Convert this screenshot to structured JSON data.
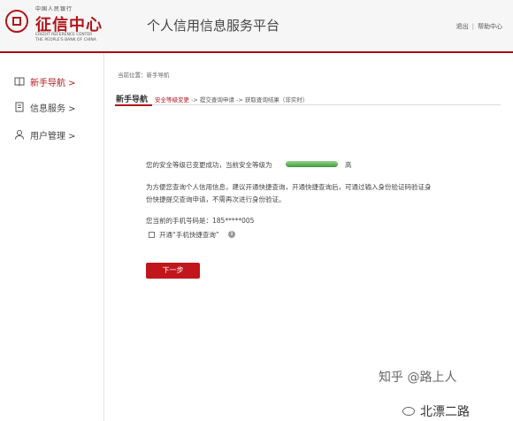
{
  "logo": {
    "top_text": "中国人民银行",
    "name": "征信中心",
    "en_line1": "CREDIT REFERENCE CENTER",
    "en_line2": "THE PEOPLE'S BANK OF CHINA"
  },
  "header": {
    "title": "个人信用信息服务平台",
    "logout": "退出",
    "separator": "|",
    "help": "帮助中心"
  },
  "sidebar": {
    "items": [
      {
        "label": "新手导航 >",
        "icon": "book-icon",
        "active": true
      },
      {
        "label": "信息服务 >",
        "icon": "document-icon",
        "active": false
      },
      {
        "label": "用户管理 >",
        "icon": "user-icon",
        "active": false
      }
    ]
  },
  "breadcrumb": "当前位置：新手导航",
  "section": {
    "title": "新手导航",
    "step_current": "安全等级变更",
    "step_rest": " -> 提交查询申请 -> 获取查询结果（非实时）"
  },
  "content": {
    "security_msg": "您的安全等级已变更成功，当前安全等级为",
    "security_level": "高",
    "explain_line1": "为方便您查询个人信用信息，建议开通快捷查询，开通快捷查询后，可通过输入身份验证码验证身",
    "explain_line2": "份快捷提交查询申请，不需再次进行身份验证。",
    "phone_label": "您当前的手机号码是：185*****005",
    "checkbox_label": "开通“手机快捷查询”",
    "next_button": "下一步"
  },
  "watermark": {
    "line1": "知乎 @路上人",
    "line2": "北漂二路"
  },
  "colors": {
    "accent": "#b0171c",
    "security_bar": "#4caf50"
  }
}
